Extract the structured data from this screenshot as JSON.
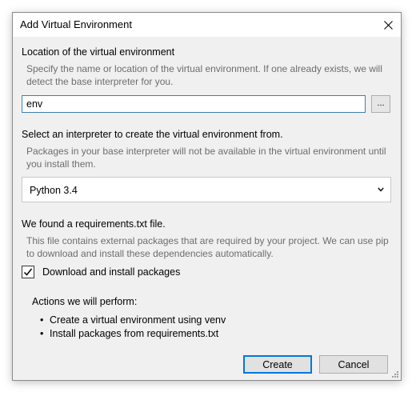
{
  "dialog": {
    "title": "Add Virtual Environment",
    "close_icon": "close-icon"
  },
  "location": {
    "heading": "Location of the virtual environment",
    "description": "Specify the name or location of the virtual environment. If one already exists, we will detect the base interpreter for you.",
    "value": "env",
    "browse_label": "..."
  },
  "interpreter": {
    "heading": "Select an interpreter to create the virtual environment from.",
    "description": "Packages in your base interpreter will not be available in the virtual environment until you install them.",
    "selected": "Python 3.4",
    "chevron_icon": "chevron-down-icon"
  },
  "requirements": {
    "heading": "We found a requirements.txt file.",
    "description": "This file contains external packages that are required by your project. We can use pip to download and install these dependencies automatically.",
    "checkbox_label": "Download and install packages",
    "checked": true
  },
  "actions": {
    "heading": "Actions we will perform:",
    "items": [
      "Create a virtual environment using venv",
      "Install packages from requirements.txt"
    ]
  },
  "buttons": {
    "create_label": "Create",
    "cancel_label": "Cancel"
  },
  "colors": {
    "accent": "#0078d7",
    "dialog_bg": "#f0f0f0",
    "muted_text": "#6d6d6d"
  }
}
